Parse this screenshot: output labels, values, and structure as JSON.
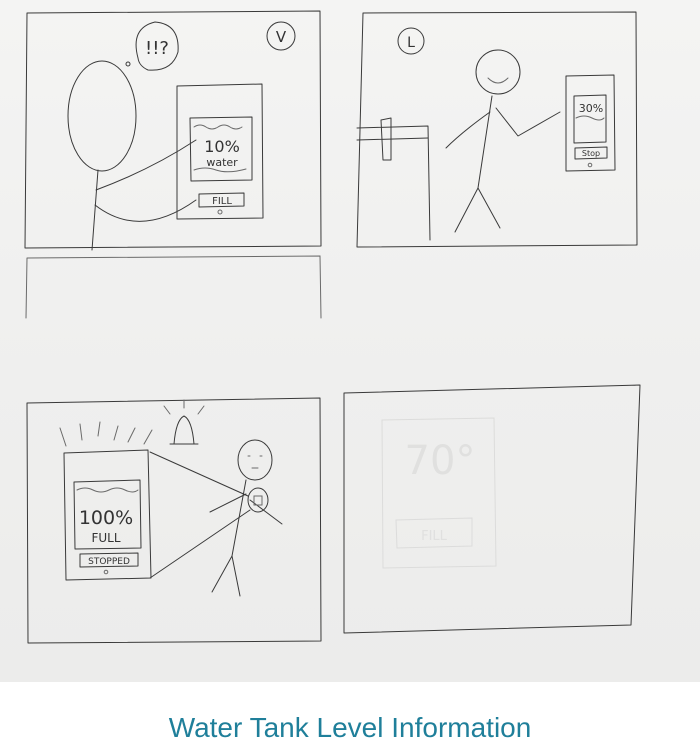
{
  "panels": {
    "p1": {
      "badge": "V",
      "exclaim": "!!?",
      "screen_level": "10%",
      "screen_word": "water",
      "button": "FILL"
    },
    "p2": {
      "badge": "L",
      "screen_level": "30%",
      "button": "Stop"
    },
    "p3": {
      "screen_level": "100%",
      "screen_word": "FULL",
      "button": "STOPPED"
    },
    "p4": {
      "ghost_level": "70°",
      "ghost_button": "FILL"
    }
  },
  "caption": "Water Tank Level Information"
}
